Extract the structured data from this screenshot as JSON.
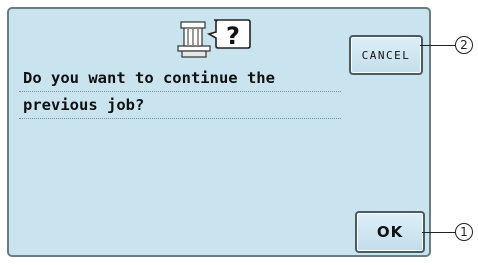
{
  "dialog": {
    "icon": "sewing-machine-question-icon",
    "message_line_1": "Do you want to continue the",
    "message_line_2": "previous job?"
  },
  "buttons": {
    "cancel_label": "CANCEL",
    "ok_label": "OK"
  },
  "callouts": {
    "ok_number": "1",
    "cancel_number": "2"
  },
  "colors": {
    "panel_background": "#c9e4ef",
    "button_background": "#d2e9f4",
    "border": "#4a5b64"
  }
}
